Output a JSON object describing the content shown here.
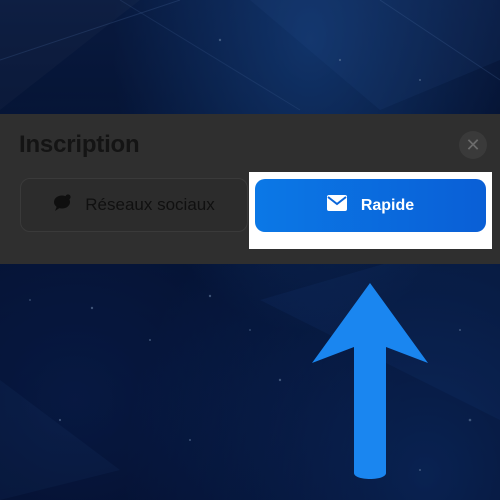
{
  "dialog": {
    "title": "Inscription",
    "close_symbol": "✕",
    "tabs": [
      {
        "label": "Réseaux sociaux",
        "icon": "chat-bubble-icon",
        "selected": false
      },
      {
        "label": "Rapide",
        "icon": "envelope-icon",
        "selected": true
      }
    ]
  },
  "annotation": {
    "type": "arrow-up",
    "color": "#1a86f0"
  },
  "colors": {
    "accent": "#0a6ee0",
    "highlight": "#ffffff"
  }
}
